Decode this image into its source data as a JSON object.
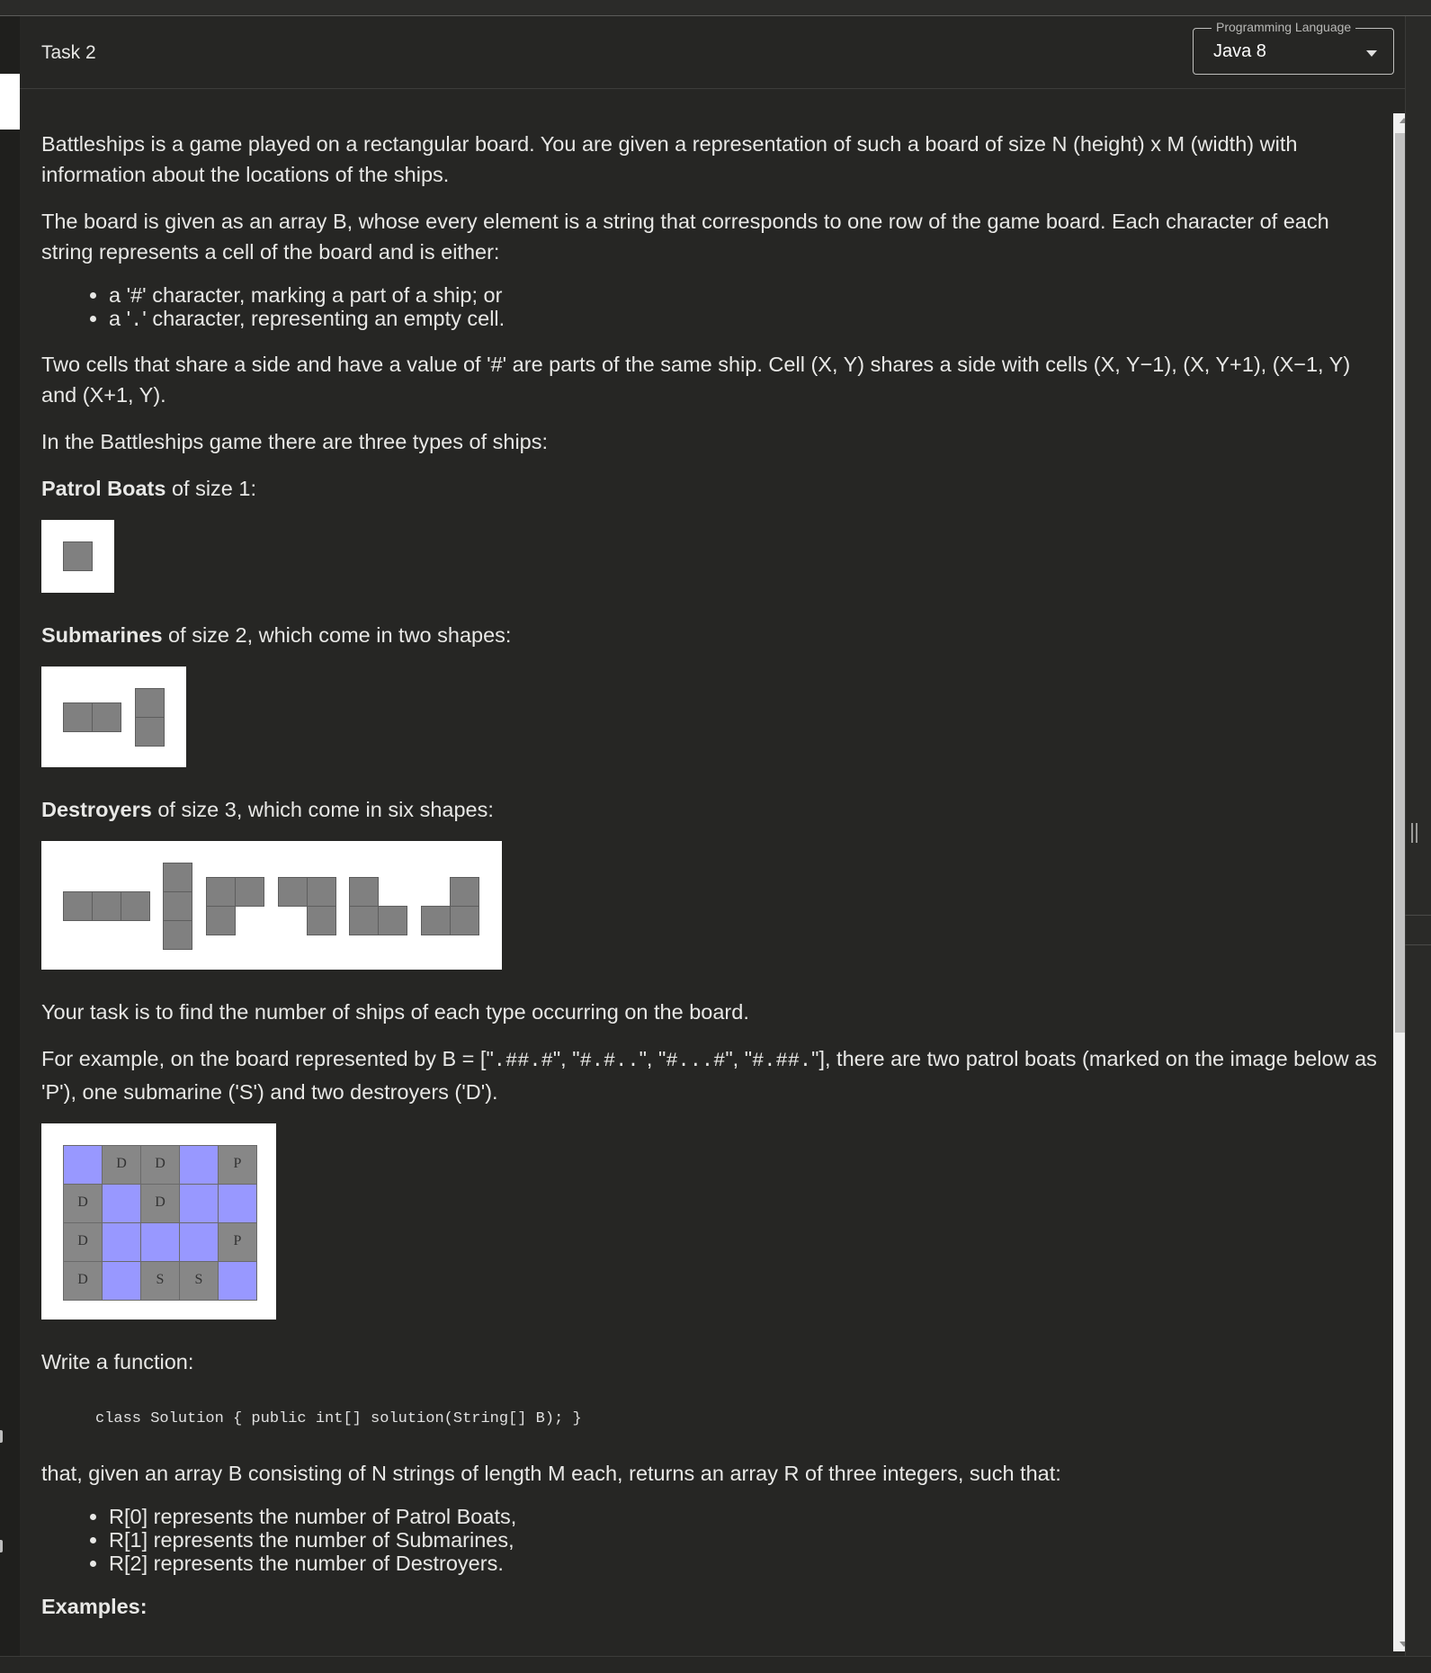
{
  "header": {
    "task_title": "Task 2",
    "language_legend": "Programming Language",
    "language_value": "Java 8"
  },
  "statement": {
    "p1": "Battleships is a game played on a rectangular board. You are given a representation of such a board of size N (height) x M (width) with information about the locations of the ships.",
    "p2": "The board is given as an array B, whose every element is a string that corresponds to one row of the game board. Each character of each string represents a cell of the board and is either:",
    "bullet1_pre": "a '",
    "bullet1_char": "#",
    "bullet1_post": "' character, marking a part of a ship; or",
    "bullet2_pre": "a '",
    "bullet2_char": ".",
    "bullet2_post": "' character, representing an empty cell.",
    "p3": "Two cells that share a side and have a value of '#' are parts of the same ship. Cell (X, Y) shares a side with cells (X, Y−1), (X, Y+1), (X−1, Y) and (X+1, Y).",
    "p4": "In the Battleships game there are three types of ships:",
    "patrol_bold": "Patrol Boats",
    "patrol_rest": " of size 1:",
    "sub_bold": "Submarines",
    "sub_rest": " of size 2, which come in two shapes:",
    "dest_bold": "Destroyers",
    "dest_rest": " of size 3, which come in six shapes:",
    "p5": "Your task is to find the number of ships of each type occurring on the board.",
    "ex_pre": "For example, on the board represented by B = [\"",
    "ex_r1": ".##.#",
    "ex_sep1": "\", \"",
    "ex_r2": "#.#..",
    "ex_sep2": "\", \"",
    "ex_r3": "#...#",
    "ex_sep3": "\", \"",
    "ex_r4": "#.##.",
    "ex_post": "\"], there are two patrol boats (marked on the image below as 'P'), one submarine ('S') and two destroyers ('D').",
    "write_fn": "Write a function:",
    "code": "class Solution { public int[] solution(String[] B); }",
    "p6": "that, given an array B consisting of N strings of length M each, returns an array R of three integers, such that:",
    "r0": "R[0] represents the number of Patrol Boats,",
    "r1": "R[1] represents the number of Submarines,",
    "r2": "R[2] represents the number of Destroyers.",
    "examples": "Examples:"
  },
  "board": {
    "rows": [
      [
        {
          "t": "water",
          "l": ""
        },
        {
          "t": "ship",
          "l": "D"
        },
        {
          "t": "ship",
          "l": "D"
        },
        {
          "t": "water",
          "l": ""
        },
        {
          "t": "ship",
          "l": "P"
        }
      ],
      [
        {
          "t": "ship",
          "l": "D"
        },
        {
          "t": "water",
          "l": ""
        },
        {
          "t": "ship",
          "l": "D"
        },
        {
          "t": "water",
          "l": ""
        },
        {
          "t": "water",
          "l": ""
        }
      ],
      [
        {
          "t": "ship",
          "l": "D"
        },
        {
          "t": "water",
          "l": ""
        },
        {
          "t": "water",
          "l": ""
        },
        {
          "t": "water",
          "l": ""
        },
        {
          "t": "ship",
          "l": "P"
        }
      ],
      [
        {
          "t": "ship",
          "l": "D"
        },
        {
          "t": "water",
          "l": ""
        },
        {
          "t": "ship",
          "l": "S"
        },
        {
          "t": "ship",
          "l": "S"
        },
        {
          "t": "water",
          "l": ""
        }
      ]
    ]
  },
  "colors": {
    "background": "#262624",
    "ship_cell": "#878787",
    "water_cell": "#9898ff"
  }
}
